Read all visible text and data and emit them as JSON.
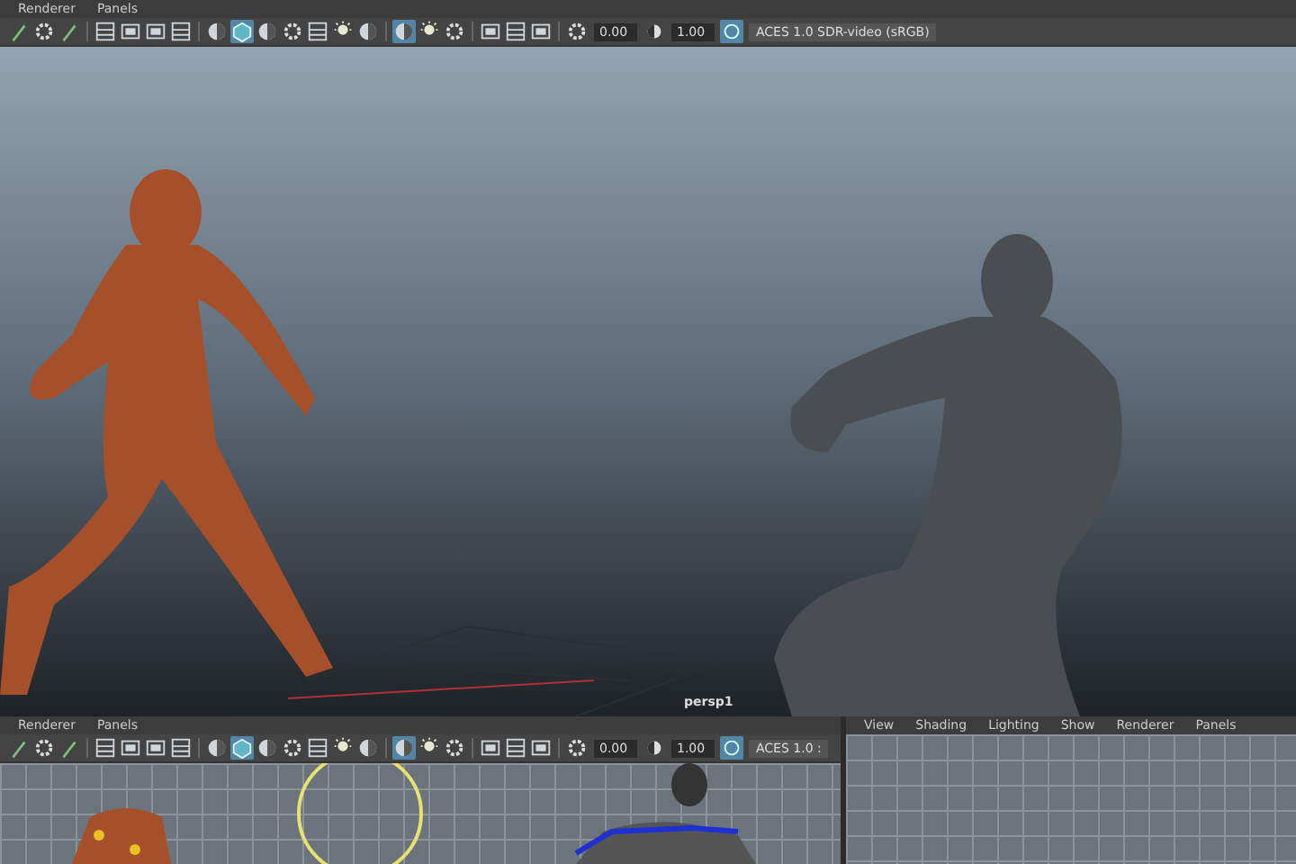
{
  "top_panel": {
    "menu": [
      "Renderer",
      "Panels"
    ],
    "toolbar": {
      "exposure": "0.00",
      "gamma": "1.00",
      "color_space": "ACES 1.0 SDR-video (sRGB)"
    },
    "camera_label": "persp1"
  },
  "bottom_left_panel": {
    "menu": [
      "Renderer",
      "Panels"
    ],
    "toolbar": {
      "exposure": "0.00",
      "gamma": "1.00",
      "color_space": "ACES 1.0 :"
    }
  },
  "bottom_right_panel": {
    "menu": [
      "View",
      "Shading",
      "Lighting",
      "Show",
      "Renderer",
      "Panels"
    ]
  }
}
